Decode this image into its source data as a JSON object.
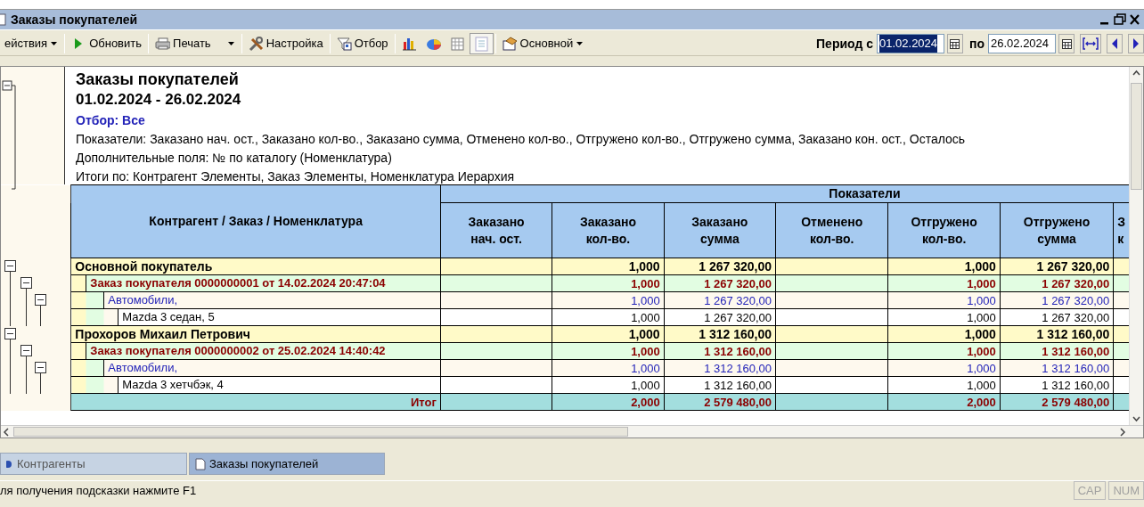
{
  "window": {
    "title": "Заказы покупателей"
  },
  "toolbar": [
    {
      "kind": "menu",
      "label": "ействия"
    },
    {
      "kind": "refresh",
      "label": "Обновить"
    },
    {
      "kind": "print",
      "label": "Печать"
    },
    {
      "kind": "dropdown"
    },
    {
      "kind": "settings",
      "label": "Настройка"
    },
    {
      "kind": "filter",
      "label": "Отбор"
    },
    {
      "kind": "chart",
      "pressed": false
    },
    {
      "kind": "diagram",
      "pressed": false
    },
    {
      "kind": "table",
      "pressed": false
    },
    {
      "kind": "layout",
      "pressed": true
    },
    {
      "kind": "variant",
      "label": "Основной"
    }
  ],
  "period": {
    "label": "Период с",
    "from": {
      "value": "01.02.2024",
      "selected": true
    },
    "to_label": "по",
    "to": {
      "value": "26.02.2024",
      "selected": false
    }
  },
  "report": {
    "title": "Заказы покупателей",
    "period": "01.02.2024 - 26.02.2024",
    "filter": "Отбор: Все",
    "info_lines": [
      "Показатели: Заказано нач. ост., Заказано кол-во., Заказано сумма, Отменено кол-во., Отгружено кол-во., Отгружено сумма, Заказано кон. ост., Осталось",
      "Дополнительные поля: № по каталогу (Номенклатура)",
      "Итоги по: Контрагент Элементы, Заказ Элементы, Номенклатура Иерархия"
    ],
    "table": {
      "name_header": "Контрагент / Заказ / Номенклатура",
      "group_header": "Показатели",
      "columns": [
        {
          "lines": [
            "Заказано",
            "нач. ост."
          ]
        },
        {
          "lines": [
            "Заказано",
            "кол-во."
          ]
        },
        {
          "lines": [
            "Заказано",
            "сумма"
          ]
        },
        {
          "lines": [
            "Отменено",
            "кол-во."
          ]
        },
        {
          "lines": [
            "Отгружено",
            "кол-во."
          ]
        },
        {
          "lines": [
            "Отгружено",
            "сумма"
          ]
        },
        {
          "lines": [
            "З",
            "к"
          ]
        }
      ],
      "rows": [
        {
          "kind": "contractor",
          "name": "Основной покупатель",
          "expanded": true,
          "values": {
            "ordered_qty": "1,000",
            "ordered_sum": "1 267 320,00",
            "shipped_qty": "1,000",
            "shipped_sum": "1 267 320,00"
          },
          "children": [
            {
              "kind": "order",
              "name": "Заказ покупателя 0000000001 от 14.02.2024 20:47:04",
              "expanded": true,
              "values": {
                "ordered_qty": "1,000",
                "ordered_sum": "1 267 320,00",
                "shipped_qty": "1,000",
                "shipped_sum": "1 267 320,00"
              },
              "children": [
                {
                  "kind": "group",
                  "name": "Автомобили,",
                  "expanded": true,
                  "values": {
                    "ordered_qty": "1,000",
                    "ordered_sum": "1 267 320,00",
                    "shipped_qty": "1,000",
                    "shipped_sum": "1 267 320,00"
                  },
                  "children": [
                    {
                      "kind": "item",
                      "name": "Mazda 3 седан, 5",
                      "values": {
                        "ordered_qty": "1,000",
                        "ordered_sum": "1 267 320,00",
                        "shipped_qty": "1,000",
                        "shipped_sum": "1 267 320,00"
                      }
                    }
                  ]
                }
              ]
            }
          ]
        },
        {
          "kind": "contractor",
          "name": "Прохоров Михаил Петрович",
          "expanded": true,
          "values": {
            "ordered_qty": "1,000",
            "ordered_sum": "1 312 160,00",
            "shipped_qty": "1,000",
            "shipped_sum": "1 312 160,00"
          },
          "children": [
            {
              "kind": "order",
              "name": "Заказ покупателя 0000000002 от 25.02.2024 14:40:42",
              "expanded": true,
              "values": {
                "ordered_qty": "1,000",
                "ordered_sum": "1 312 160,00",
                "shipped_qty": "1,000",
                "shipped_sum": "1 312 160,00"
              },
              "children": [
                {
                  "kind": "group",
                  "name": "Автомобили,",
                  "expanded": true,
                  "values": {
                    "ordered_qty": "1,000",
                    "ordered_sum": "1 312 160,00",
                    "shipped_qty": "1,000",
                    "shipped_sum": "1 312 160,00"
                  },
                  "children": [
                    {
                      "kind": "item",
                      "name": "Mazda 3 хетчбэк, 4",
                      "values": {
                        "ordered_qty": "1,000",
                        "ordered_sum": "1 312 160,00",
                        "shipped_qty": "1,000",
                        "shipped_sum": "1 312 160,00"
                      }
                    }
                  ]
                }
              ]
            }
          ]
        }
      ],
      "total": {
        "label": "Итог",
        "values": {
          "ordered_qty": "2,000",
          "ordered_sum": "2 579 480,00",
          "shipped_qty": "2,000",
          "shipped_sum": "2 579 480,00"
        }
      }
    }
  },
  "tabs": [
    {
      "label": "Контрагенты",
      "selected": false
    },
    {
      "label": "Заказы покупателей",
      "selected": true
    }
  ],
  "status_bar": {
    "hint": "ля получения подсказки нажмите F1",
    "indicators": [
      {
        "label": "CAP",
        "on": false
      },
      {
        "label": "NUM",
        "on": false
      }
    ]
  }
}
